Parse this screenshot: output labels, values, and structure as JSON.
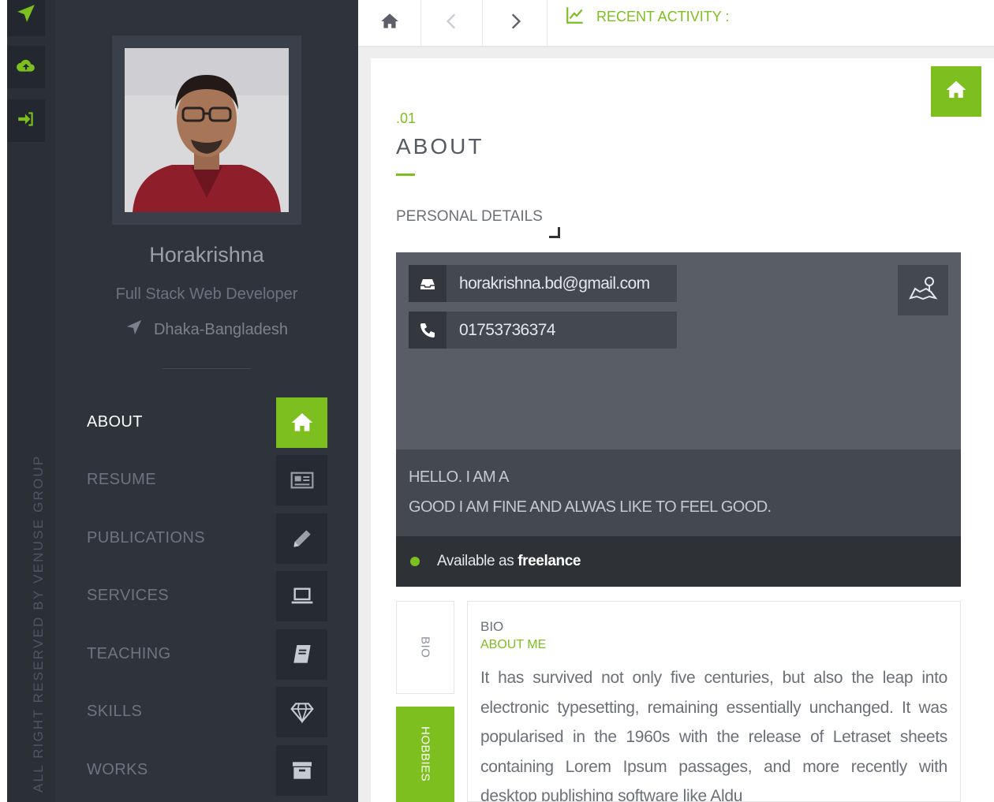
{
  "rail": {
    "buttons": [
      {
        "icon": "send-icon"
      },
      {
        "icon": "cloud-upload-icon"
      },
      {
        "icon": "sign-in-icon"
      }
    ],
    "copyright": "ALL RIGHT RESERVED BY VENUSE GROUP"
  },
  "profile": {
    "name": "Horakrishna",
    "role": "Full Stack Web Developer",
    "location": "Dhaka-Bangladesh"
  },
  "nav": {
    "items": [
      {
        "label": "ABOUT",
        "icon": "home-icon",
        "active": true
      },
      {
        "label": "RESUME",
        "icon": "newspaper-icon",
        "active": false
      },
      {
        "label": "PUBLICATIONS",
        "icon": "pencil-icon",
        "active": false
      },
      {
        "label": "SERVICES",
        "icon": "laptop-icon",
        "active": false
      },
      {
        "label": "TEACHING",
        "icon": "book-icon",
        "active": false
      },
      {
        "label": "SKILLS",
        "icon": "diamond-icon",
        "active": false
      },
      {
        "label": "WORKS",
        "icon": "archive-icon",
        "active": false
      }
    ]
  },
  "topbar": {
    "recent_label": "RECENT ACTIVITY :"
  },
  "section": {
    "number": ".01",
    "title": "ABOUT",
    "personal_details_label": "PERSONAL DETAILS"
  },
  "contact": {
    "email": "horakrishna.bd@gmail.com",
    "phone": "01753736374"
  },
  "intro": {
    "line1": "HELLO. I AM A",
    "line2": "GOOD I AM FINE AND ALWAS LIKE TO FEEL GOOD."
  },
  "availability": {
    "prefix": "Available as",
    "status": "freelance"
  },
  "bio": {
    "tabs": [
      "BIO",
      "HOBBIES"
    ],
    "title": "BIO",
    "subtitle": "ABOUT ME",
    "text": "It has survived not only five centuries, but also the leap into electronic typesetting, remaining essentially unchanged. It was popularised in the 1960s with the release of Letraset sheets containing Lorem Ipsum passages, and more recently with desktop publishing software like Aldu"
  },
  "colors": {
    "accent": "#7cbf1e",
    "sidebar": "#2f343c",
    "panel": "#595d65"
  }
}
